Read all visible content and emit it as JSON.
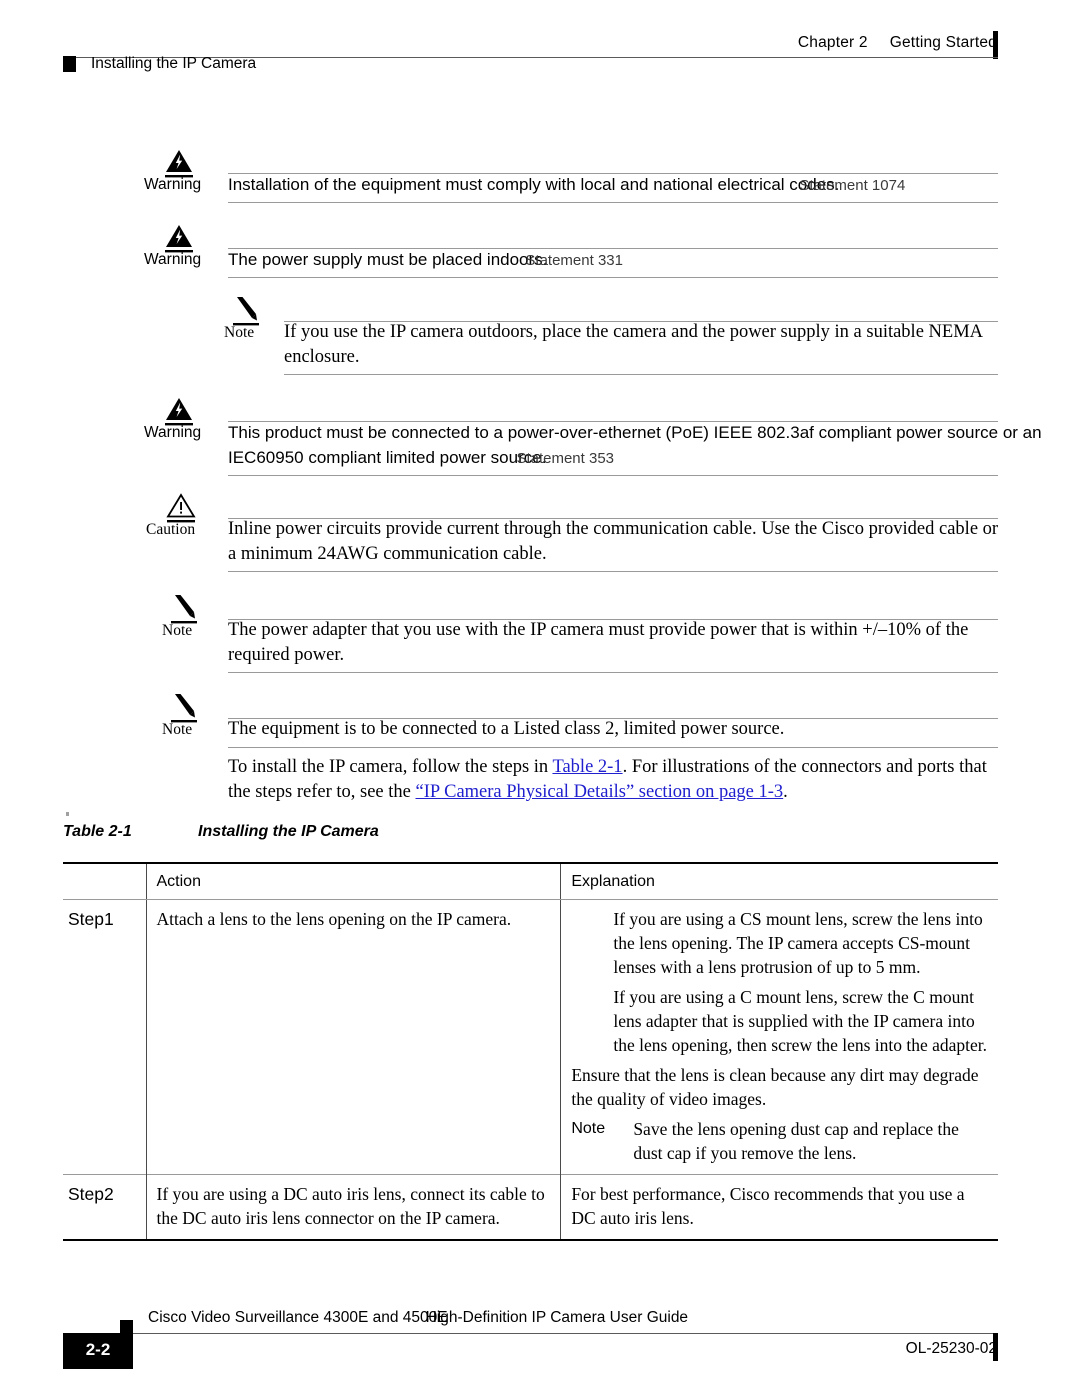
{
  "header": {
    "chapter": "Chapter 2",
    "chapter_title": "Getting Started",
    "section": "Installing the IP Camera"
  },
  "admonitions": [
    {
      "kind": "Warning",
      "icon": "warning-lightning-triangle-icon",
      "label": "Warning",
      "text": "Installation of the equipment must comply with local and national electrical codes.",
      "statement": "Statement 1074"
    },
    {
      "kind": "Warning",
      "icon": "warning-lightning-triangle-icon",
      "label": "Warning",
      "text": "The power supply must be placed indoors.",
      "statement": "Statement 331"
    },
    {
      "kind": "Note",
      "icon": "note-pencil-icon",
      "label": "Note",
      "text": "If you use the IP camera outdoors, place the camera and the power supply in a suitable NEMA enclosure.",
      "statement": ""
    },
    {
      "kind": "Warning",
      "icon": "warning-lightning-triangle-icon",
      "label": "Warning",
      "text": "This product must be connected to a power-over-ethernet (PoE) IEEE 802.3af compliant power source or an IEC60950 compliant limited power source.",
      "statement": "Statement 353"
    },
    {
      "kind": "Caution",
      "icon": "caution-exclamation-triangle-icon",
      "label": "Caution",
      "text": "Inline power circuits provide current through the communication cable. Use the Cisco provided cable or a minimum 24AWG communication cable.",
      "statement": ""
    },
    {
      "kind": "Note",
      "icon": "note-pencil-icon",
      "label": "Note",
      "text": "The power adapter that you use with the IP camera must provide power that is within +/–10% of the required power.",
      "statement": ""
    },
    {
      "kind": "Note",
      "icon": "note-pencil-icon",
      "label": "Note",
      "text": "The equipment is to be connected to a Listed class 2, limited power source.",
      "statement": ""
    }
  ],
  "intro_paragraph": {
    "part1": "To install the IP camera, follow the steps in ",
    "link1": "Table 2-1",
    "part2": ". For illustrations of the connectors and ports that the steps refer to, see the ",
    "link2": "“IP Camera Physical Details” section on page 1-3",
    "part3": "."
  },
  "table": {
    "caption_number": "Table 2-1",
    "caption_title": "Installing the IP Camera",
    "headers": {
      "step": "",
      "action": "Action",
      "explanation": "Explanation"
    },
    "rows": [
      {
        "step": "Step1",
        "action": "Attach a lens to the lens opening on the IP camera.",
        "explanation_paragraphs": [
          "If you are using a CS mount lens, screw the lens into the lens opening. The IP camera accepts CS-mount lenses with a lens protrusion of up to 5 mm.",
          "If you are using a C mount lens, screw the C mount lens adapter that is supplied with the IP camera into the lens opening, then screw the lens into the adapter.",
          "Ensure that the lens is clean because any dirt may degrade the quality of video images."
        ],
        "explanation_note_label": "Note",
        "explanation_note_text": "Save the lens opening dust cap and replace the dust cap if you remove the lens."
      },
      {
        "step": "Step2",
        "action": "If you are using a DC auto iris lens, connect its cable to the DC auto iris lens connector on the IP camera.",
        "explanation_paragraphs": [
          "For best performance, Cisco recommends that you use a DC auto iris lens."
        ],
        "explanation_note_label": "",
        "explanation_note_text": ""
      }
    ]
  },
  "footer": {
    "page_number": "2-2",
    "doc_title_a": "Cisco Video Surveillance 4300E and 4500E",
    "doc_title_b": "High-Definition IP Camera User Guide",
    "doc_id": "OL-25230-02"
  },
  "colors": {
    "link": "#2020cf",
    "rule": "#9a9a9a",
    "table_border": "#000000"
  }
}
